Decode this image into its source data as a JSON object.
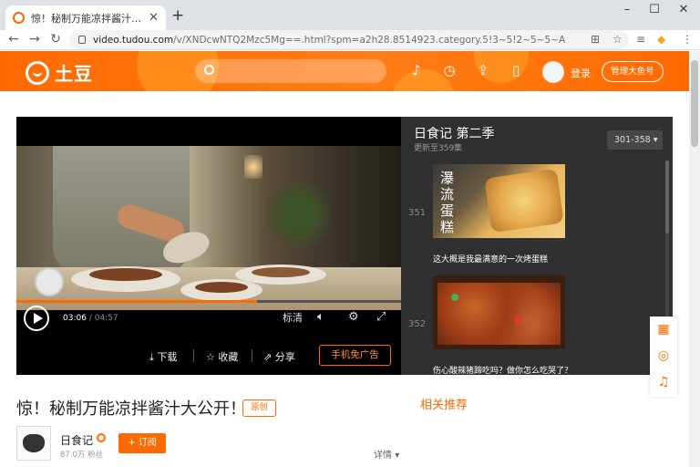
{
  "browser": {
    "tab_title": "惊！秘制万能凉拌酱汁大公开！...",
    "new_tab": "+",
    "url_host": "video.tudou.com",
    "url_path": "/v/XNDcwNTQ2Mzc5Mg==.html?spm=a2h28.8514923.category.5!3~5!2~5~5~A",
    "win_minimize": "–",
    "win_maximize": "☐",
    "win_close": "✕"
  },
  "header": {
    "logo_text": "土豆",
    "login_label": "登录",
    "manage_label": "管理大鱼号"
  },
  "player": {
    "current_time": "03:06",
    "duration": "04:57",
    "progress": 0.626,
    "quality_label": "标清",
    "download_label": "下载",
    "favorite_label": "收藏",
    "share_label": "分享",
    "mobile_label": "手机免广告"
  },
  "playlist": {
    "series_title": "日食记 第二季",
    "update_info": "更新至359集",
    "range_label": "301-358",
    "episodes": [
      {
        "number": "351",
        "caption": "这大概是我最满意的一次烤蛋糕",
        "thumb_text": "瀑 流 蛋 糕"
      },
      {
        "number": "352",
        "caption": "伤心酸辣猪蹄吃吗？做你怎么吃哭了？"
      }
    ]
  },
  "video": {
    "title": "惊！秘制万能凉拌酱汁大公开！",
    "original_badge": "原创",
    "related_label": "相关推荐"
  },
  "channel": {
    "name": "日食记",
    "fans": "87.0万 粉丝",
    "subscribe_label": "+ 订阅",
    "details_label": "详情"
  },
  "colors": {
    "brand": "#ff6a00",
    "panel_bg": "#303030"
  }
}
